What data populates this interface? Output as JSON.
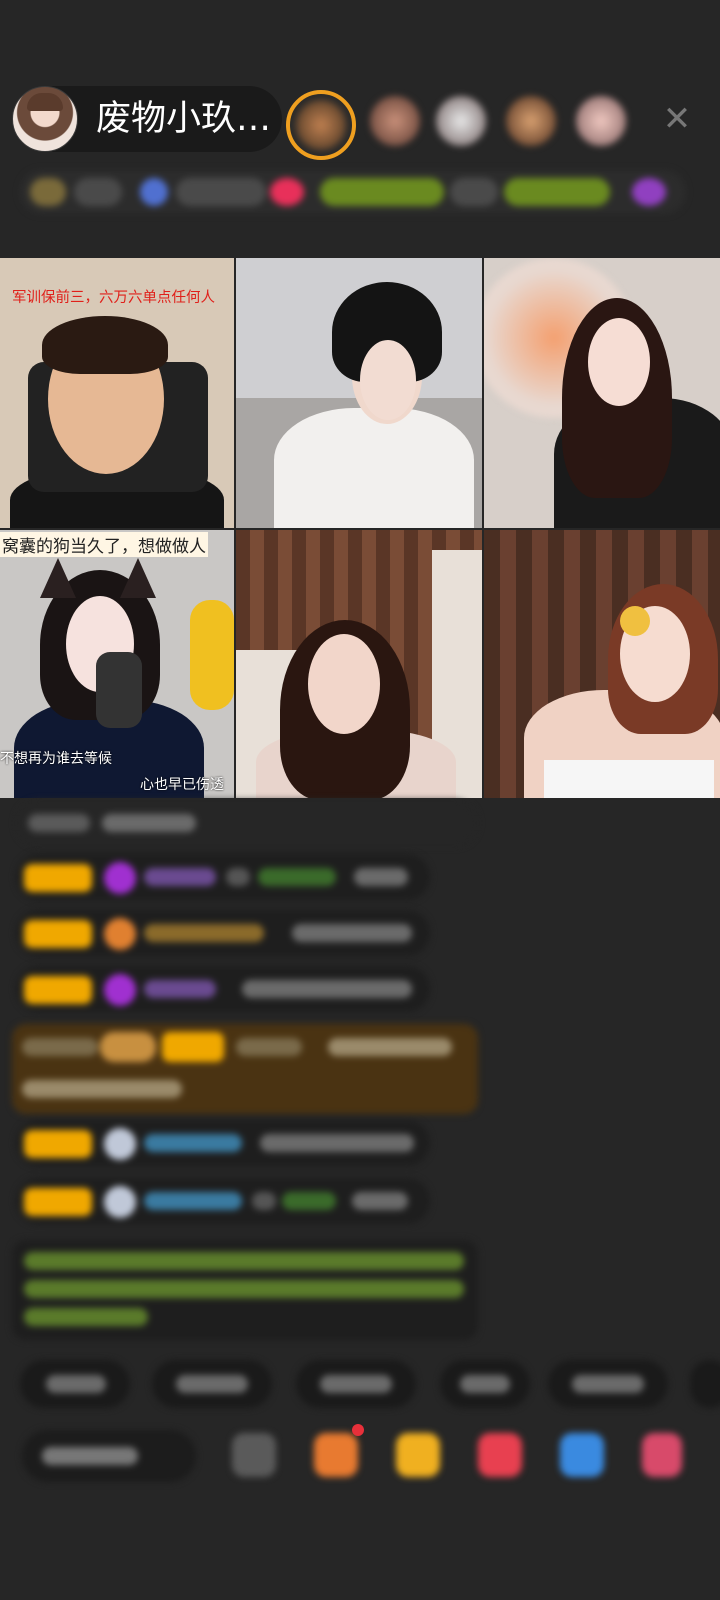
{
  "host": {
    "name": "废物小玖…",
    "avatar_icon": "host-avatar"
  },
  "top_viewers": [
    {
      "icon": "viewer-avatar-1",
      "ring": "#f0a020"
    },
    {
      "icon": "viewer-avatar-2",
      "ring": ""
    },
    {
      "icon": "viewer-avatar-3",
      "ring": ""
    },
    {
      "icon": "viewer-avatar-4",
      "ring": ""
    },
    {
      "icon": "viewer-avatar-5",
      "ring": ""
    }
  ],
  "close_icon": "close-icon",
  "video_tiles": [
    {
      "caption": "军训保前三，六万六单点任何人"
    },
    {
      "caption": ""
    },
    {
      "caption": ""
    },
    {
      "caption": "窝囊的狗当久了，想做做人",
      "caption_2": "不想再为谁去等候",
      "caption_3": "心也早已伤透"
    },
    {
      "caption": ""
    },
    {
      "caption": ""
    }
  ],
  "colors": {
    "background": "#262626",
    "badge_orange": "#f0a800",
    "purple_gem": "#a030d0",
    "teal_name": "#3aa0c8",
    "green_text": "#8ac040",
    "pink_gift": "#e8305a"
  },
  "bottom_icons": [
    "emoji-icon",
    "gift-box-icon",
    "treasure-icon",
    "heart-game-icon",
    "game-controller-icon",
    "more-apps-icon"
  ]
}
